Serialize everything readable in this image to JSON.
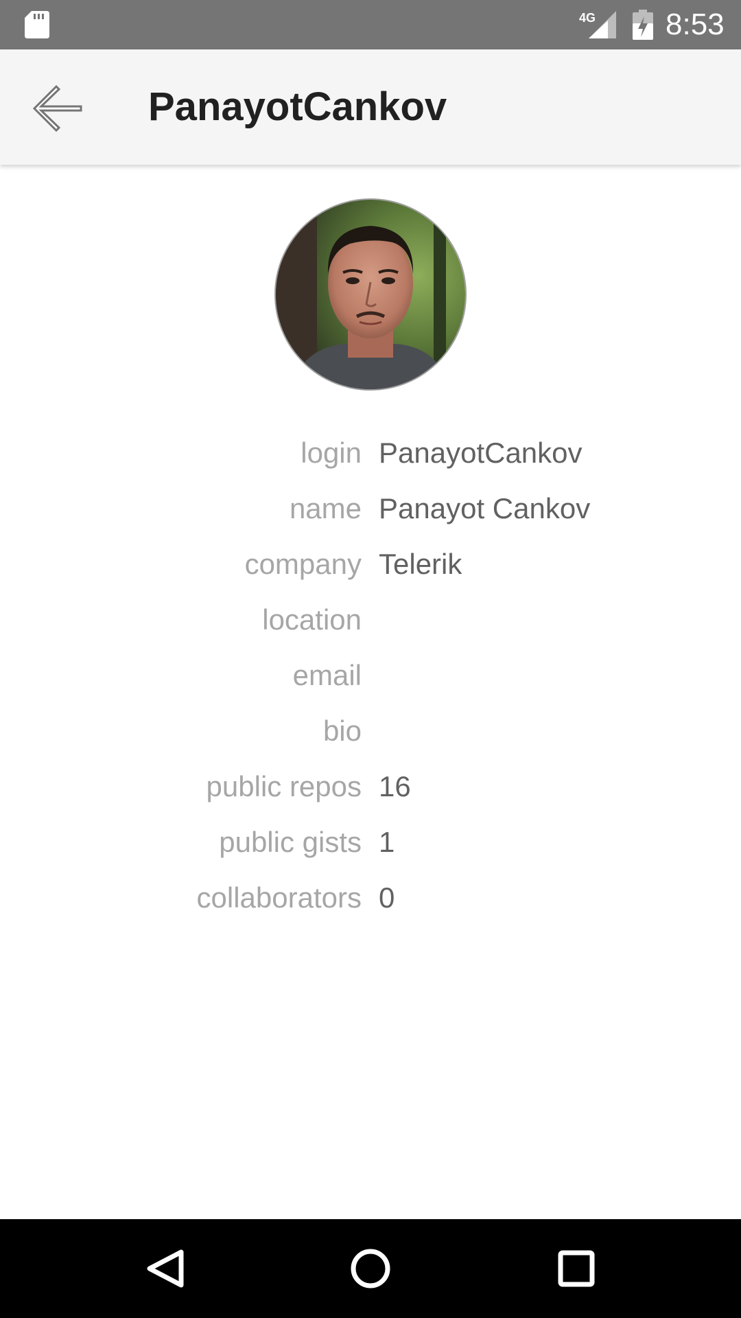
{
  "status_bar": {
    "time": "8:53",
    "network_label": "4G",
    "icons": [
      "sd-card-icon",
      "signal-4g-icon",
      "battery-charging-icon"
    ],
    "background": "#757575"
  },
  "app_bar": {
    "back_icon": "back-arrow-icon",
    "title": "PanayotCankov",
    "background": "#f5f5f5"
  },
  "profile": {
    "avatar_icon": "user-avatar",
    "fields": [
      {
        "label": "login",
        "value": "PanayotCankov"
      },
      {
        "label": "name",
        "value": "Panayot Cankov"
      },
      {
        "label": "company",
        "value": "Telerik"
      },
      {
        "label": "location",
        "value": ""
      },
      {
        "label": "email",
        "value": ""
      },
      {
        "label": "bio",
        "value": ""
      },
      {
        "label": "public repos",
        "value": "16"
      },
      {
        "label": "public gists",
        "value": "1"
      },
      {
        "label": "collaborators",
        "value": "0"
      }
    ],
    "label_color": "#a6a6a6",
    "value_color": "#616161"
  },
  "nav_bar": {
    "icons": [
      "nav-back-icon",
      "nav-home-icon",
      "nav-recents-icon"
    ],
    "background": "#000000"
  }
}
